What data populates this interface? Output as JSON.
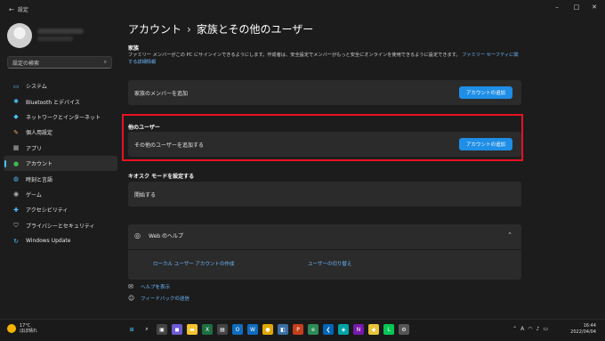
{
  "window": {
    "title": "設定"
  },
  "sidebar": {
    "search_placeholder": "設定の検索",
    "items": [
      {
        "label": "システム",
        "icon": "monitor-icon",
        "color": "#4cc2ff"
      },
      {
        "label": "Bluetooth とデバイス",
        "icon": "bluetooth-icon",
        "color": "#4cc2ff"
      },
      {
        "label": "ネットワークとインターネット",
        "icon": "wifi-icon",
        "color": "#4cc2ff"
      },
      {
        "label": "個人用設定",
        "icon": "brush-icon",
        "color": "#f7a35c"
      },
      {
        "label": "アプリ",
        "icon": "apps-icon",
        "color": "#b3b3b3"
      },
      {
        "label": "アカウント",
        "icon": "person-icon",
        "color": "#3fb950",
        "active": true
      },
      {
        "label": "時刻と言語",
        "icon": "globe-clock-icon",
        "color": "#4cc2ff"
      },
      {
        "label": "ゲーム",
        "icon": "gamepad-icon",
        "color": "#b3b3b3"
      },
      {
        "label": "アクセシビリティ",
        "icon": "accessibility-icon",
        "color": "#4cc2ff"
      },
      {
        "label": "プライバシーとセキュリティ",
        "icon": "shield-icon",
        "color": "#b3b3b3"
      },
      {
        "label": "Windows Update",
        "icon": "refresh-icon",
        "color": "#4cc2ff"
      }
    ]
  },
  "main": {
    "breadcrumb_parent": "アカウント",
    "breadcrumb_sep": "›",
    "page_title": "家族とその他のユーザー",
    "family": {
      "heading": "家族",
      "description": "ファミリー メンバーがこの PC にサインインできるようにします。作成者は、安全設定でメンバーがもっと安全にオンラインを使用できるように設定できます。",
      "link": "ファミリー セーフティに関する詳細情報",
      "add_label": "家族のメンバーを追加",
      "add_button": "アカウントの追加"
    },
    "other_users": {
      "heading": "他のユーザー",
      "add_label": "その他のユーザーを追加する",
      "add_button": "アカウントの追加"
    },
    "kiosk": {
      "heading": "キオスク モードを設定する",
      "start_label": "開始する"
    },
    "help": {
      "title": "Web のヘルプ",
      "link1": "ローカル ユーザー アカウントの作成",
      "link2": "ユーザーの切り替え"
    },
    "footer": {
      "get_help": "ヘルプを表示",
      "feedback": "フィードバックの送信"
    }
  },
  "taskbar": {
    "weather_temp": "17°C",
    "weather_desc": "ほぼ晴れ",
    "time": "16:44",
    "date": "2022/04/04",
    "lang": "A"
  },
  "accent": "#4cc2ff",
  "highlight_color": "#e81123"
}
